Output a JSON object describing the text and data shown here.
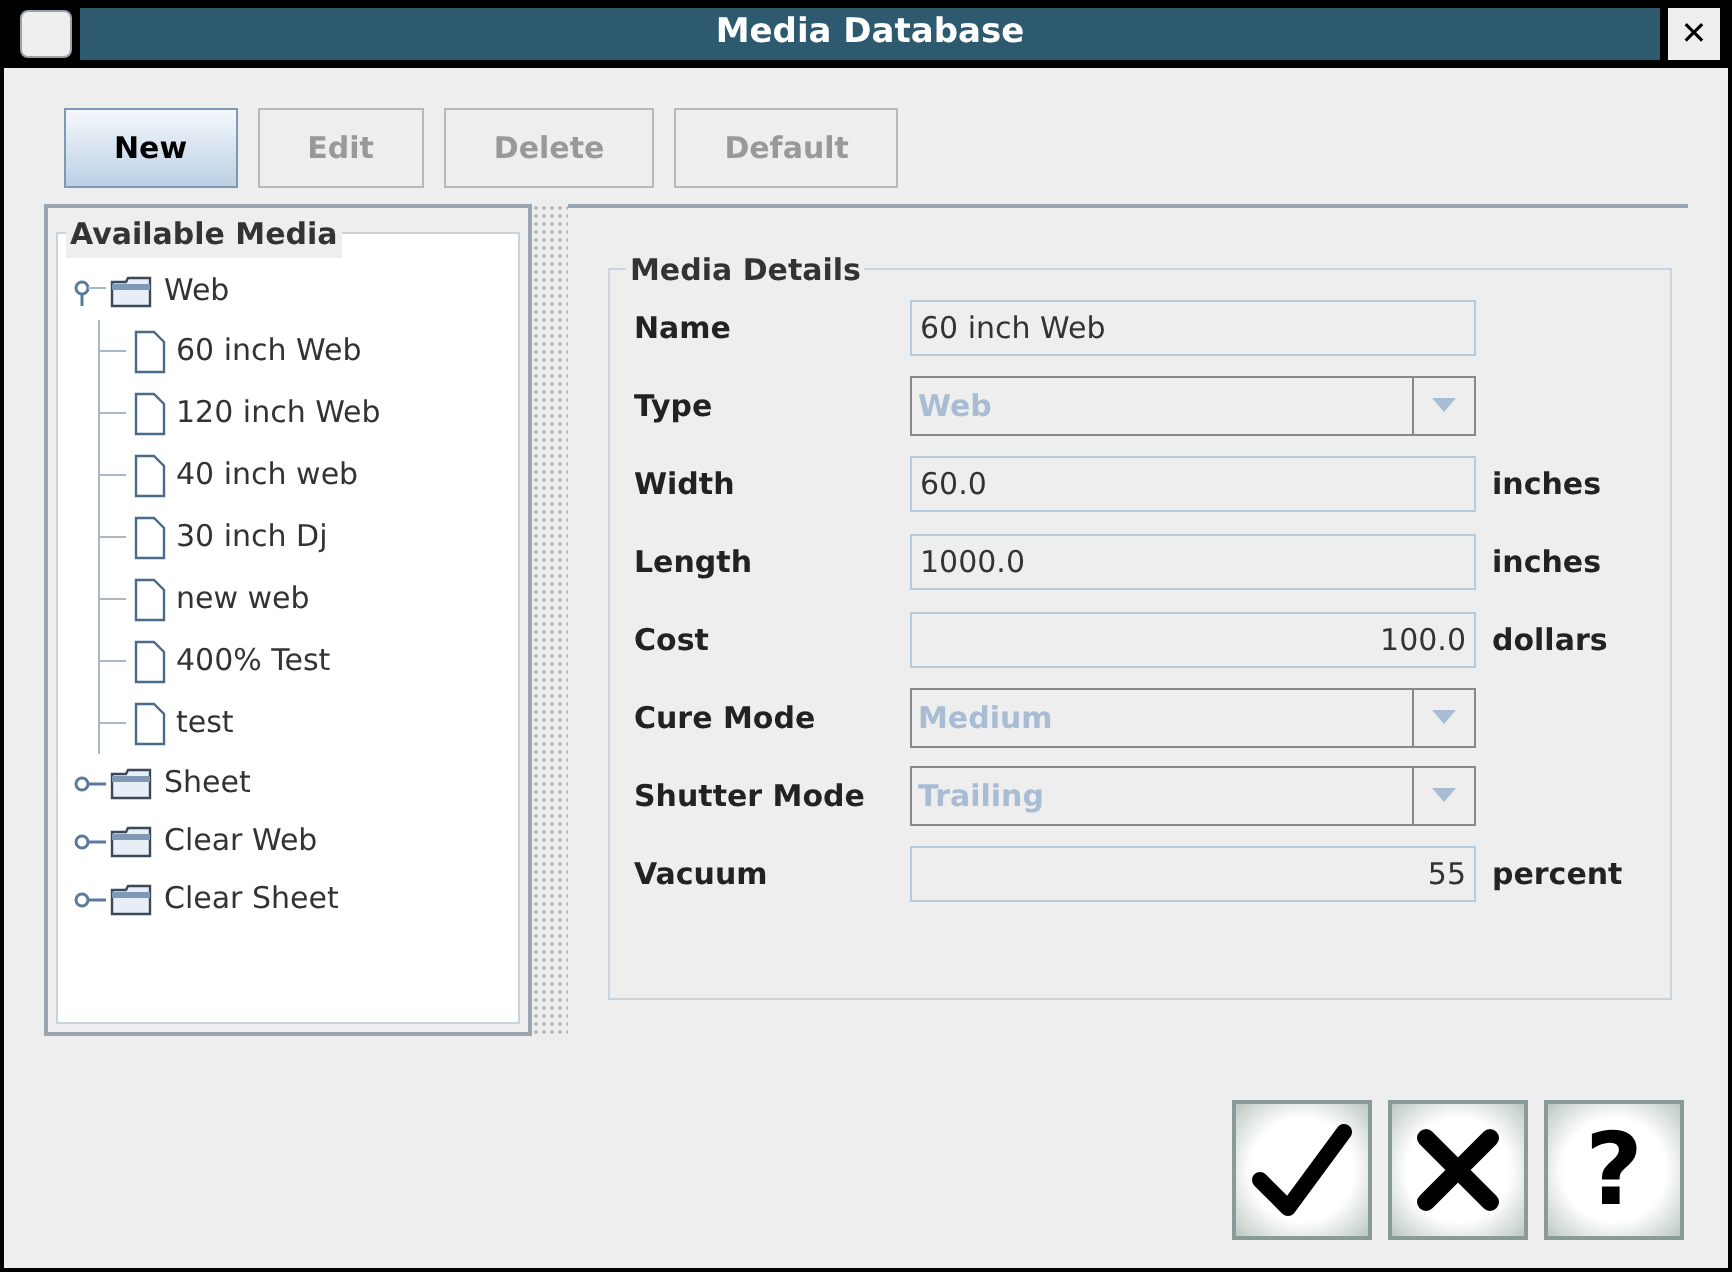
{
  "window": {
    "title": "Media Database",
    "close": "✕"
  },
  "toolbar": [
    {
      "label": "New",
      "disabled": false,
      "selected": true
    },
    {
      "label": "Edit",
      "disabled": true,
      "selected": false
    },
    {
      "label": "Delete",
      "disabled": true,
      "selected": false
    },
    {
      "label": "Default",
      "disabled": true,
      "selected": false
    }
  ],
  "tree": {
    "title": "Available Media",
    "items": [
      {
        "label": "Web",
        "expanded": true,
        "children": [
          {
            "label": "60 inch Web"
          },
          {
            "label": "120 inch Web"
          },
          {
            "label": "40 inch web"
          },
          {
            "label": "30 inch Dj"
          },
          {
            "label": "new web"
          },
          {
            "label": "400% Test"
          },
          {
            "label": "test"
          }
        ]
      },
      {
        "label": "Sheet",
        "expanded": false
      },
      {
        "label": "Clear Web",
        "expanded": false
      },
      {
        "label": "Clear Sheet",
        "expanded": false
      }
    ]
  },
  "details": {
    "title": "Media Details",
    "fields": [
      {
        "label": "Name",
        "kind": "text",
        "value": "60 inch Web"
      },
      {
        "label": "Type",
        "kind": "combo",
        "value": "Web",
        "disabled": true
      },
      {
        "label": "Width",
        "kind": "text",
        "value": "60.0",
        "unit": "inches"
      },
      {
        "label": "Length",
        "kind": "text",
        "value": "1000.0",
        "unit": "inches"
      },
      {
        "label": "Cost",
        "kind": "number",
        "value": "100.0",
        "unit": "dollars"
      },
      {
        "label": "Cure Mode",
        "kind": "combo",
        "value": "Medium",
        "disabled": true
      },
      {
        "label": "Shutter Mode",
        "kind": "combo",
        "value": "Trailing",
        "disabled": true
      },
      {
        "label": "Vacuum",
        "kind": "number",
        "value": "55",
        "unit": "percent"
      }
    ]
  },
  "footer": {
    "help": "?"
  }
}
